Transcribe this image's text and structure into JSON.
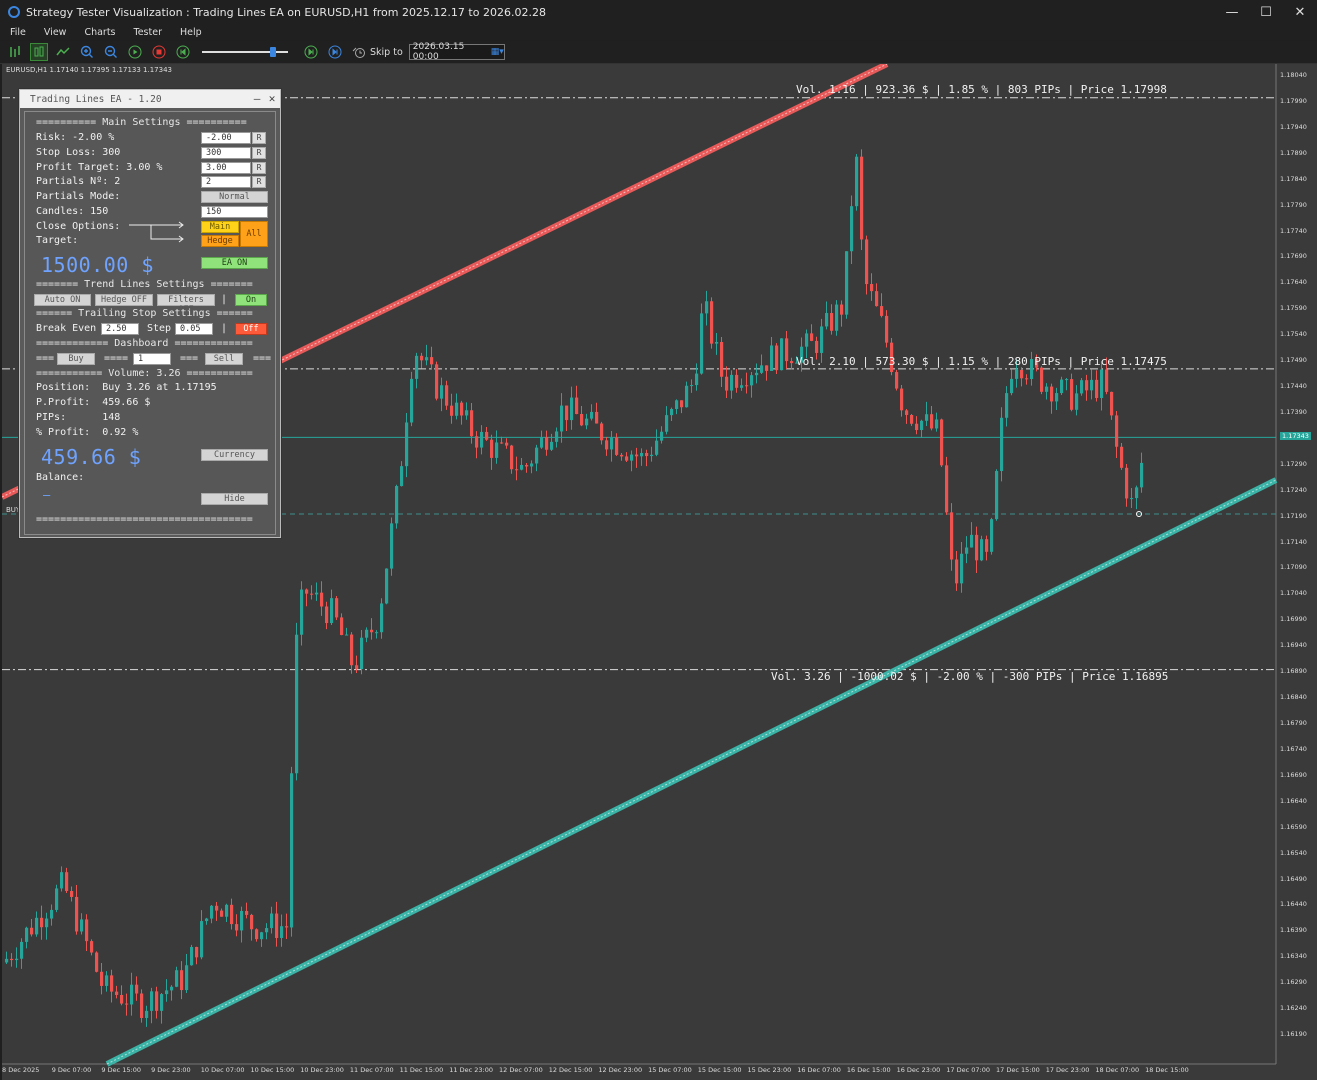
{
  "window": {
    "title": "Strategy Tester Visualization : Trading Lines EA on EURUSD,H1 from 2025.12.17 to 2026.02.28",
    "minimize": "—",
    "maximize": "☐",
    "close": "✕"
  },
  "menu": [
    "File",
    "View",
    "Charts",
    "Tester",
    "Help"
  ],
  "toolbar": {
    "skip_label": "Skip to",
    "skip_value": "2026.03.15 00:00",
    "speed_fraction": 0.85
  },
  "chart": {
    "symbol_line": "EURUSD,H1  1.17140  1.17395  1.17133  1.17343",
    "buy_tag": "BUY",
    "current_price": "1.17343",
    "annotations": [
      "Vol. 1.16 | 923.36 $ | 1.85 % | 803 PIPs | Price 1.17998",
      "Vol. 2.10 | 573.30 $ | 1.15 % | 280 PIPs | Price 1.17475",
      "Vol. 3.26 | -1000.02 $ | -2.00 % | -300 PIPs | Price 1.16895"
    ],
    "price_labels": [
      "1.18040",
      "1.17990",
      "1.17940",
      "1.17890",
      "1.17840",
      "1.17790",
      "1.17740",
      "1.17690",
      "1.17640",
      "1.17590",
      "1.17540",
      "1.17490",
      "1.17440",
      "1.17390",
      "1.17343",
      "1.17290",
      "1.17240",
      "1.17190",
      "1.17140",
      "1.17090",
      "1.17040",
      "1.16990",
      "1.16940",
      "1.16890",
      "1.16840",
      "1.16790",
      "1.16740",
      "1.16690",
      "1.16640",
      "1.16590",
      "1.16540",
      "1.16490",
      "1.16440",
      "1.16390",
      "1.16340",
      "1.16290",
      "1.16240",
      "1.16190"
    ],
    "time_labels": [
      "8 Dec 2025",
      "9 Dec 07:00",
      "9 Dec 15:00",
      "9 Dec 23:00",
      "10 Dec 07:00",
      "10 Dec 15:00",
      "10 Dec 23:00",
      "11 Dec 07:00",
      "11 Dec 15:00",
      "11 Dec 23:00",
      "12 Dec 07:00",
      "12 Dec 15:00",
      "12 Dec 23:00",
      "15 Dec 07:00",
      "15 Dec 15:00",
      "15 Dec 23:00",
      "16 Dec 07:00",
      "16 Dec 15:00",
      "16 Dec 23:00",
      "17 Dec 07:00",
      "17 Dec 15:00",
      "17 Dec 23:00",
      "18 Dec 07:00",
      "18 Dec 15:00"
    ],
    "colors": {
      "bull": "#26a69a",
      "bear": "#ef5350",
      "background": "#3a3a3a"
    }
  },
  "panel": {
    "title": "Trading Lines EA - 1.20",
    "min": "—",
    "close": "✕",
    "main_settings": "========== Main Settings ==========",
    "risk_label": "Risk: -2.00 %",
    "risk_value": "-2.00",
    "sl_label": "Stop Loss: 300",
    "sl_value": "300",
    "pt_label": "Profit Target: 3.00 %",
    "pt_value": "3.00",
    "partials_label": "Partials Nº: 2",
    "partials_value": "2",
    "r": "R",
    "pmode_label": "Partials Mode:",
    "pmode_value": "Normal",
    "candles_label": "Candles: 150",
    "candles_value": "150",
    "close_opts_label": "Close Options:",
    "target_label": "Target:",
    "main_btn": "Main",
    "hedge_btn": "Hedge",
    "all_btn": "All",
    "balance_big": "1500.00 $",
    "ea_btn": "EA ON",
    "trend_settings": "======= Trend Lines Settings =======",
    "auto_btn": "Auto ON",
    "hedge_off_btn": "Hedge OFF",
    "filters_btn": "Filters OFF",
    "on_btn": "On",
    "trailing_settings": "====== Trailing Stop Settings ======",
    "be_label": "Break Even",
    "be_value": "2.50",
    "step_label": "Step",
    "step_value": "0.05",
    "off_btn": "Off",
    "dashboard": "============ Dashboard =============",
    "dash_left": "===",
    "buy_btn": "Buy",
    "dash_mid": "====",
    "lot_value": "1",
    "dash_mid2": "===",
    "sell_btn": "Sell",
    "dash_right": "===",
    "volume_line": "=========== Volume: 3.26 ===========",
    "position_line": "Position:  Buy 3.26 at 1.17195",
    "pprofit_line": "P.Profit:  459.66 $",
    "pips_line": "PIPs:      148",
    "pct_line": "% Profit:  0.92 %",
    "profit_big": "459.66 $",
    "currency_btn": "Currency",
    "balance_label": "Balance:",
    "balance_dash": "–",
    "hide_btn": "Hide",
    "bottom_sep": "===================================="
  }
}
